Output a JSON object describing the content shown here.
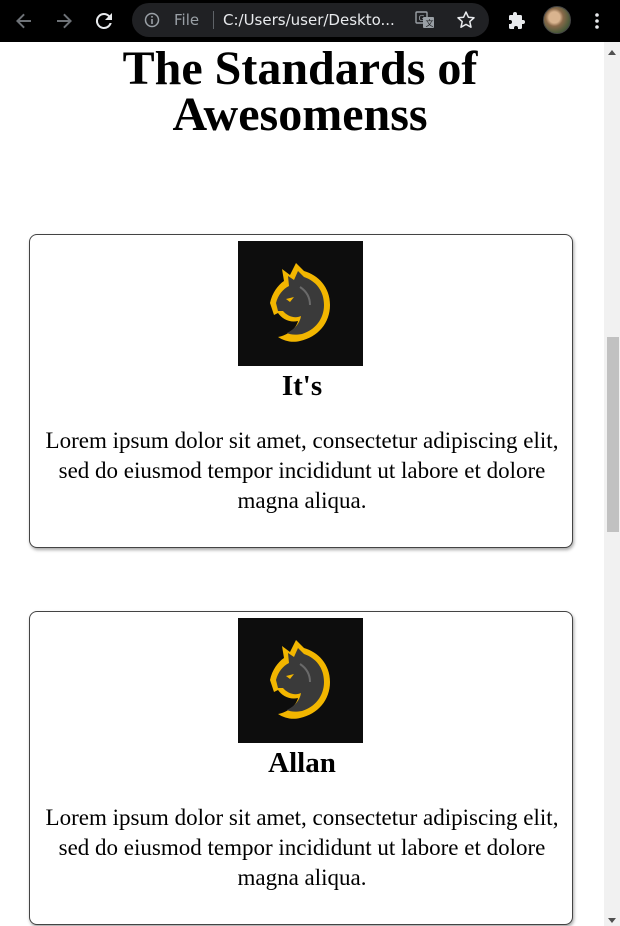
{
  "browser": {
    "omnibox_scheme_label": "File",
    "omnibox_url": "C:/Users/user/Deskto...",
    "icons": [
      "back-arrow-icon",
      "forward-arrow-icon",
      "reload-icon",
      "info-icon",
      "translate-icon",
      "bookmark-star-icon",
      "extensions-puzzle-icon",
      "profile-avatar",
      "more-vert-icon"
    ]
  },
  "page": {
    "title_line1": "The Standards of",
    "title_line2": "Awesomenss"
  },
  "cards": [
    {
      "name": "It's",
      "description": "Lorem ipsum dolor sit amet, consectetur adipiscing elit, sed do eiusmod tempor incididunt ut labore et dolore magna aliqua.",
      "logo": "wolf-logo"
    },
    {
      "name": "Allan",
      "description": "Lorem ipsum dolor sit amet, consectetur adipiscing elit, sed do eiusmod tempor incididunt ut labore et dolore magna aliqua.",
      "logo": "wolf-logo"
    }
  ],
  "colors": {
    "chrome_bg": "#000000",
    "omnibox_bg": "#202124",
    "logo_bg": "#0d0d0d",
    "logo_accent": "#f2b600"
  }
}
